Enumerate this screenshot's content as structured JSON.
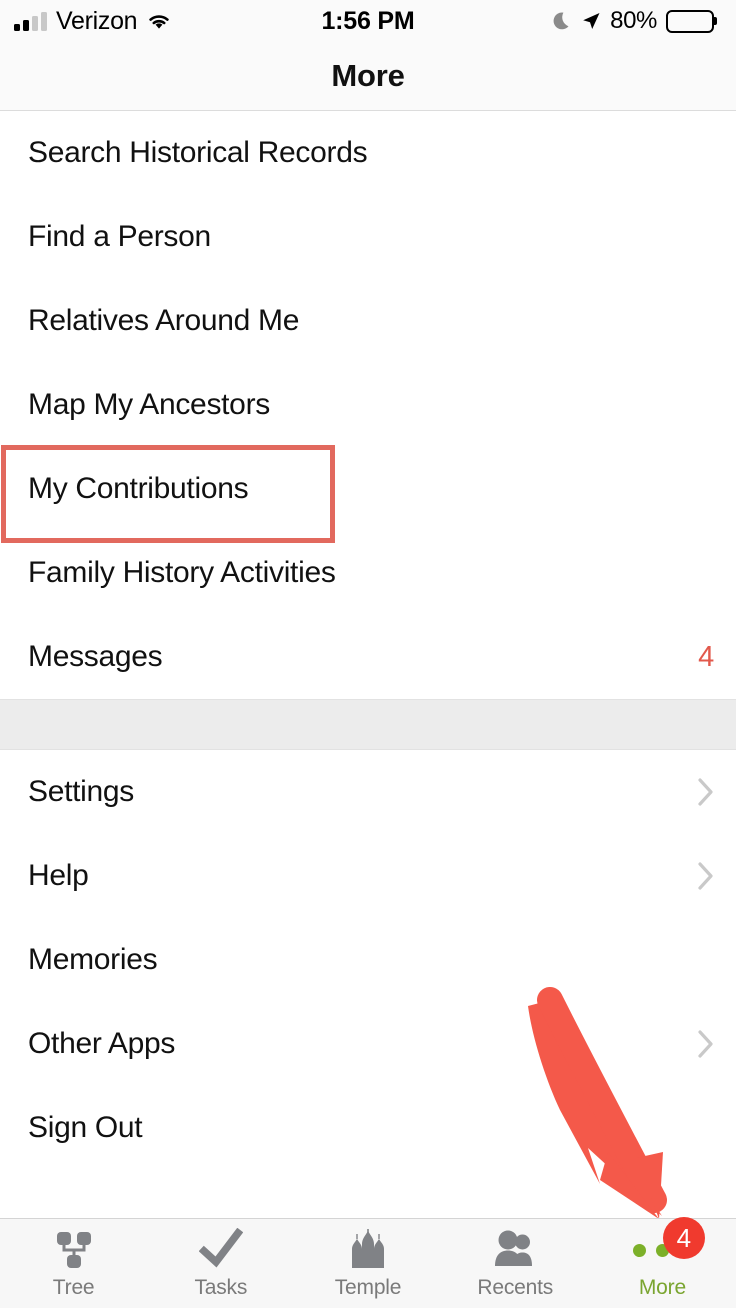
{
  "status_bar": {
    "carrier": "Verizon",
    "time": "1:56 PM",
    "battery_percent": "80%",
    "icons": [
      "signal-bars-icon",
      "wifi-icon",
      "moon-dnd-icon",
      "location-arrow-icon",
      "battery-icon"
    ]
  },
  "header": {
    "title": "More"
  },
  "menu": {
    "group_one": [
      {
        "label": "Search Historical Records",
        "accessory": "none"
      },
      {
        "label": "Find a Person",
        "accessory": "none"
      },
      {
        "label": "Relatives Around Me",
        "accessory": "none"
      },
      {
        "label": "Map My Ancestors",
        "accessory": "none"
      },
      {
        "label": "My Contributions",
        "accessory": "none",
        "highlighted": true
      },
      {
        "label": "Family History Activities",
        "accessory": "none"
      },
      {
        "label": "Messages",
        "accessory": "count",
        "count": "4"
      }
    ],
    "group_two": [
      {
        "label": "Settings",
        "accessory": "chevron"
      },
      {
        "label": "Help",
        "accessory": "chevron"
      },
      {
        "label": "Memories",
        "accessory": "none"
      },
      {
        "label": "Other Apps",
        "accessory": "chevron"
      },
      {
        "label": "Sign Out",
        "accessory": "none"
      }
    ]
  },
  "tab_bar": {
    "tabs": [
      {
        "label": "Tree",
        "icon": "family-tree-icon",
        "active": false
      },
      {
        "label": "Tasks",
        "icon": "checkmark-icon",
        "active": false
      },
      {
        "label": "Temple",
        "icon": "temple-icon",
        "active": false
      },
      {
        "label": "Recents",
        "icon": "two-people-icon",
        "active": false
      },
      {
        "label": "More",
        "icon": "three-dots-icon",
        "active": true,
        "badge": "4"
      }
    ]
  },
  "annotation": {
    "arrow": "red-arrow-pointing-to-more-tab",
    "highlight_box": "red-rectangle-around-my-contributions"
  },
  "colors": {
    "accent_green": "#7cb029",
    "badge_red": "#f03a2e",
    "annotation_red": "#f4594a",
    "highlight_red": "#e2695e",
    "count_red": "#e2594c",
    "text_primary": "#111111",
    "tab_inactive": "#7a7a7a",
    "separator_gray": "#ececec"
  }
}
